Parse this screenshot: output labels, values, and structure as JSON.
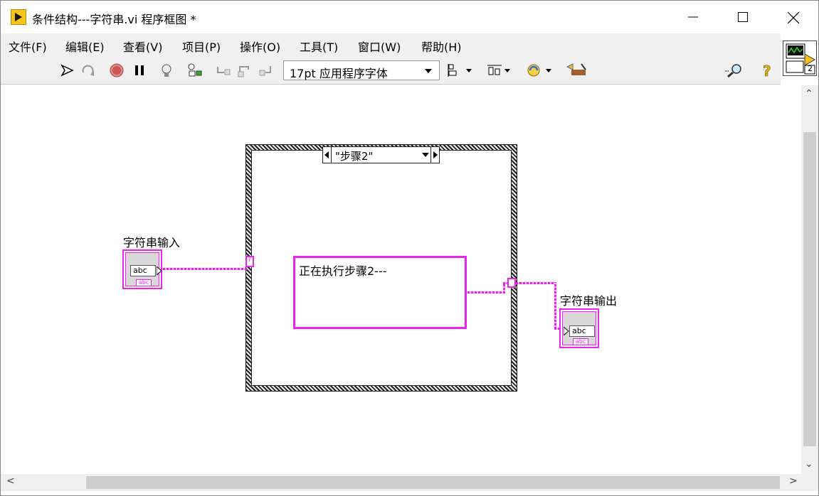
{
  "window": {
    "title": "条件结构---字符串.vi 程序框图 *"
  },
  "menu": {
    "items": [
      {
        "label": "文件(F)"
      },
      {
        "label": "编辑(E)"
      },
      {
        "label": "查看(V)"
      },
      {
        "label": "项目(P)"
      },
      {
        "label": "操作(O)"
      },
      {
        "label": "工具(T)"
      },
      {
        "label": "窗口(W)"
      },
      {
        "label": "帮助(H)"
      }
    ]
  },
  "toolbar": {
    "font_select": "17pt 应用程序字体",
    "icons": [
      "run-arrow-icon",
      "run-continuous-icon",
      "abort-icon",
      "pause-icon",
      "highlight-execution-icon",
      "retain-wire-values-icon",
      "step-into-icon",
      "step-over-icon",
      "step-out-icon",
      "align-objects-icon",
      "distribute-objects-icon",
      "reorder-icon",
      "cleanup-diagram-icon",
      "search-icon",
      "help-icon"
    ]
  },
  "connector_pane": {
    "number": "2"
  },
  "diagram": {
    "case_selector": "\"步骤2\"",
    "string_constant": "正在执行步骤2---",
    "input_terminal": {
      "label": "字符串输入",
      "type_text": "abc",
      "sub_text": "abc"
    },
    "output_terminal": {
      "label": "字符串输出",
      "type_text": "abc",
      "sub_text": "abc"
    },
    "selector_tunnel": "?"
  },
  "colors": {
    "string_wire": "#ee22ee",
    "chrome": "#f0f0f0"
  }
}
